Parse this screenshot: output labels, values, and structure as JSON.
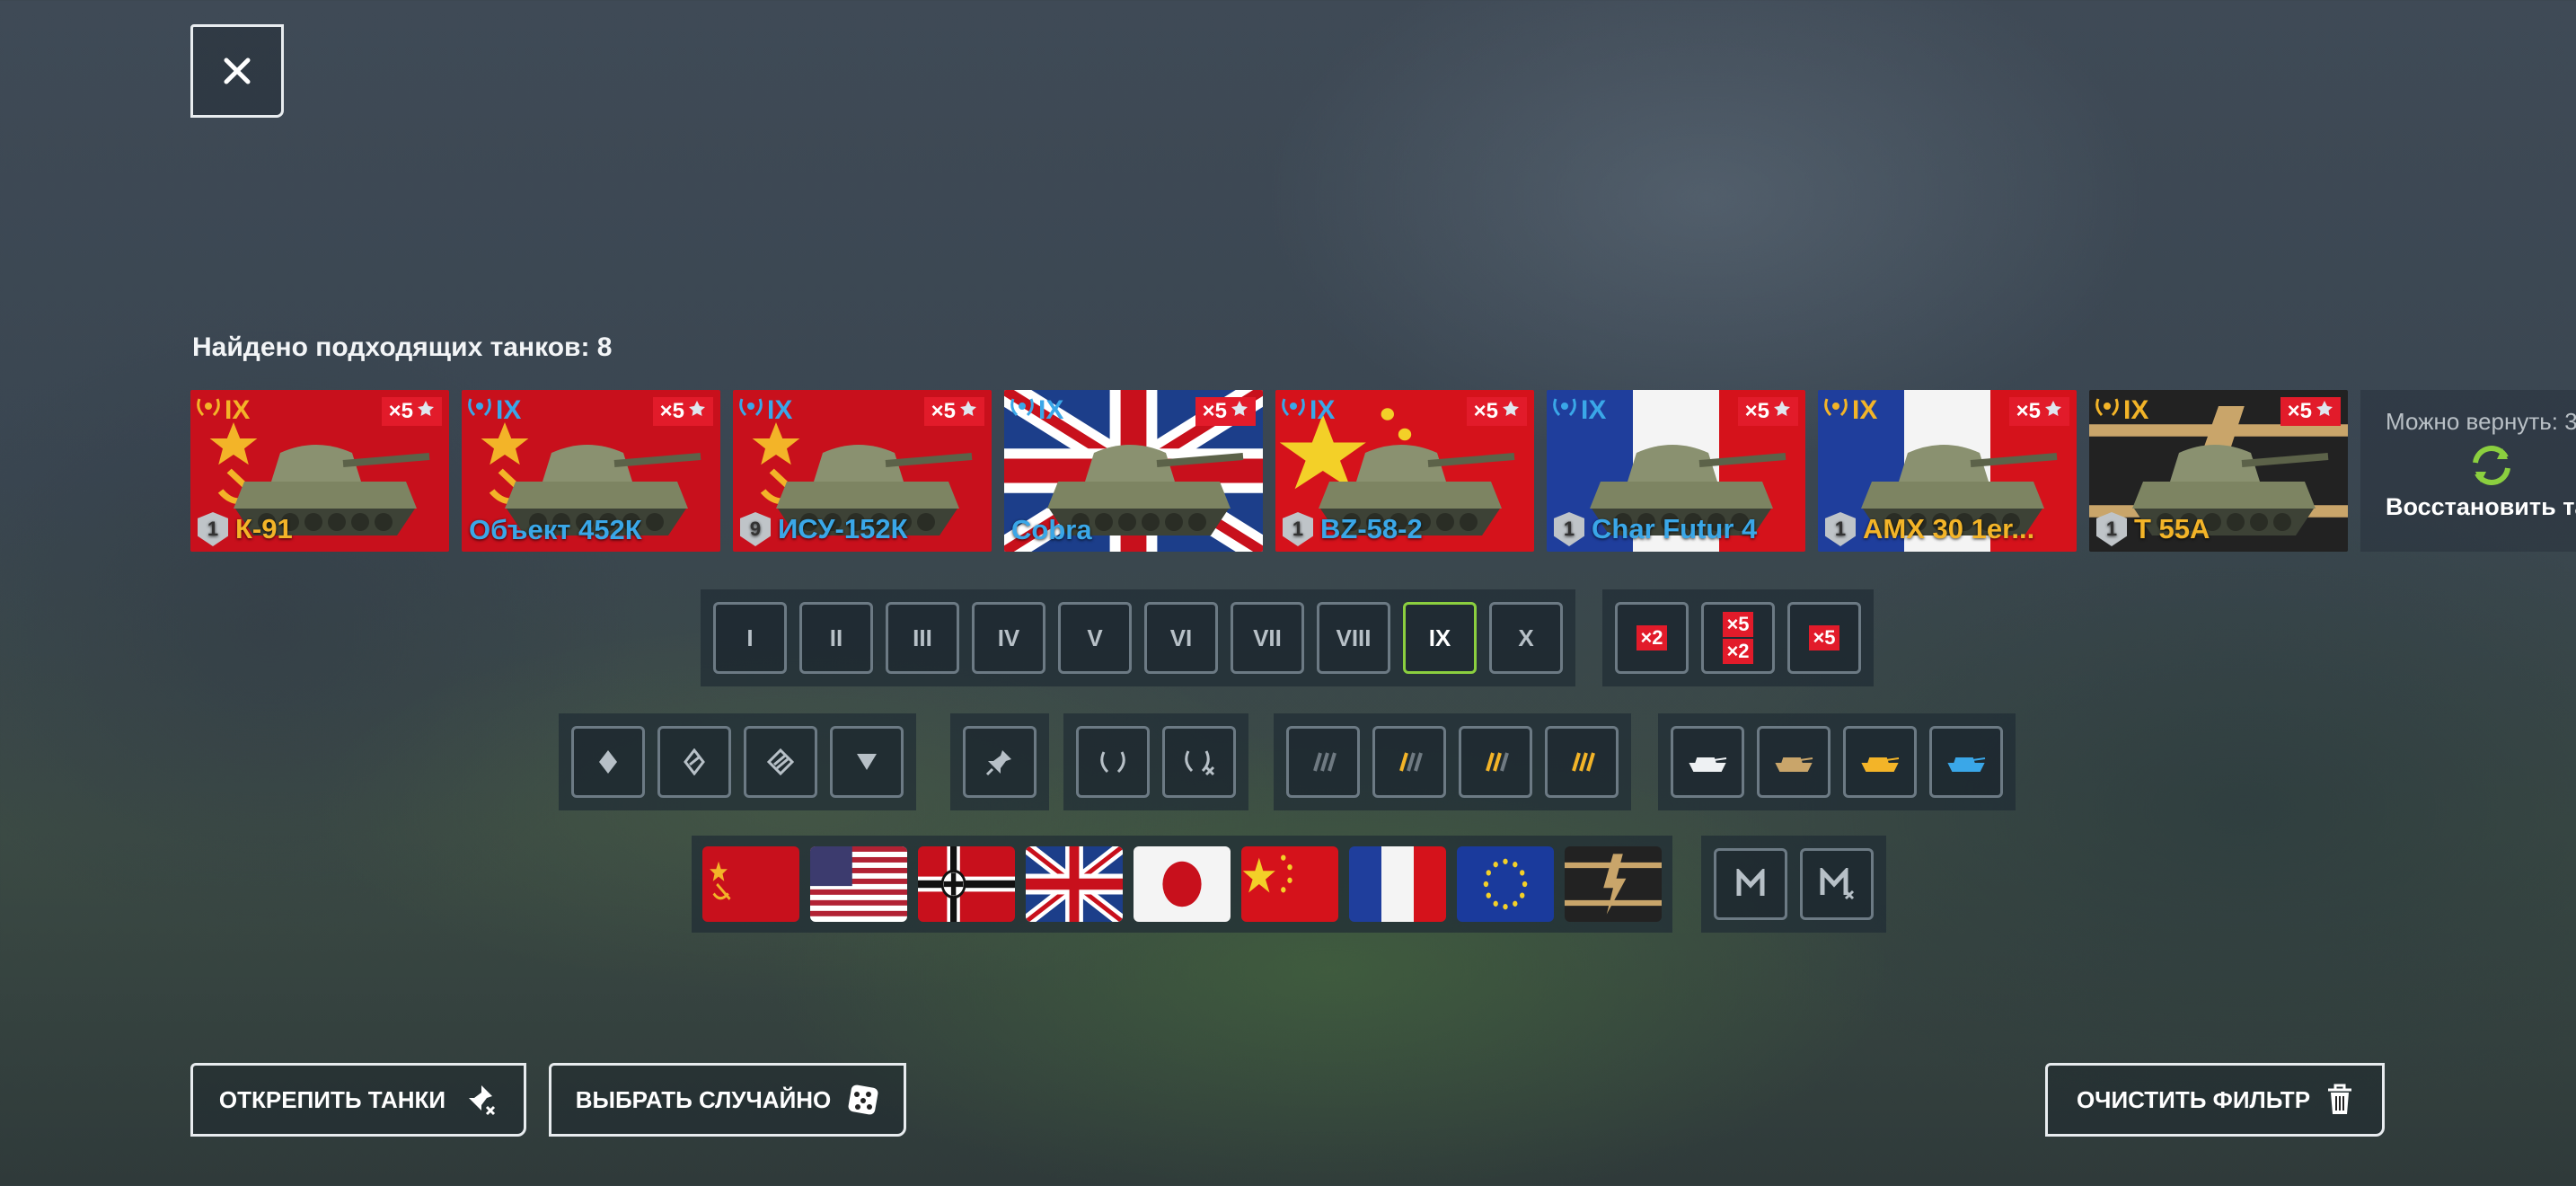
{
  "window": {
    "close_label": "×"
  },
  "results": {
    "title": "Найдено подходящих танков: 8"
  },
  "tanks": [
    {
      "name": "К-91",
      "tier": "IX",
      "level": "1",
      "mult": "×5",
      "name_color": "gold",
      "flag": "ussr"
    },
    {
      "name": "Объект 452К",
      "tier": "IX",
      "level": "",
      "mult": "×5",
      "name_color": "blue",
      "flag": "ussr"
    },
    {
      "name": "ИСУ-152К",
      "tier": "IX",
      "level": "9",
      "mult": "×5",
      "name_color": "blue",
      "flag": "ussr"
    },
    {
      "name": "Cobra",
      "tier": "IX",
      "level": "",
      "mult": "×5",
      "name_color": "blue",
      "flag": "uk"
    },
    {
      "name": "BZ-58-2",
      "tier": "IX",
      "level": "1",
      "mult": "×5",
      "name_color": "blue",
      "flag": "china"
    },
    {
      "name": "Char Futur 4",
      "tier": "IX",
      "level": "1",
      "mult": "×5",
      "name_color": "blue",
      "flag": "france"
    },
    {
      "name": "AMX 30 1er...",
      "tier": "IX",
      "level": "1",
      "mult": "×5",
      "name_color": "gold",
      "flag": "france"
    },
    {
      "name": "T 55A",
      "tier": "IX",
      "level": "1",
      "mult": "×5",
      "name_color": "gold",
      "flag": "mixed"
    }
  ],
  "restore": {
    "line1": "Можно вернуть: 3",
    "line2": "Восстановить та"
  },
  "tiers": [
    "I",
    "II",
    "III",
    "IV",
    "V",
    "VI",
    "VII",
    "VIII",
    "IX",
    "X"
  ],
  "active_tier": "IX",
  "multipliers": {
    "a": "×2",
    "b1": "×5",
    "b2": "×2",
    "c": "×5"
  },
  "nations": [
    "ussr",
    "usa",
    "germany",
    "uk",
    "japan",
    "china",
    "france",
    "europe",
    "mixed"
  ],
  "buttons": {
    "unpin": "ОТКРЕПИТЬ ТАНКИ",
    "random": "ВЫБРАТЬ СЛУЧАЙНО",
    "clear": "ОЧИСТИТЬ ФИЛЬТР"
  },
  "colors": {
    "accent_green": "#8bcf3f",
    "badge_red": "#e21b2a",
    "gold": "#f3b428",
    "blue": "#3aa7e8"
  }
}
